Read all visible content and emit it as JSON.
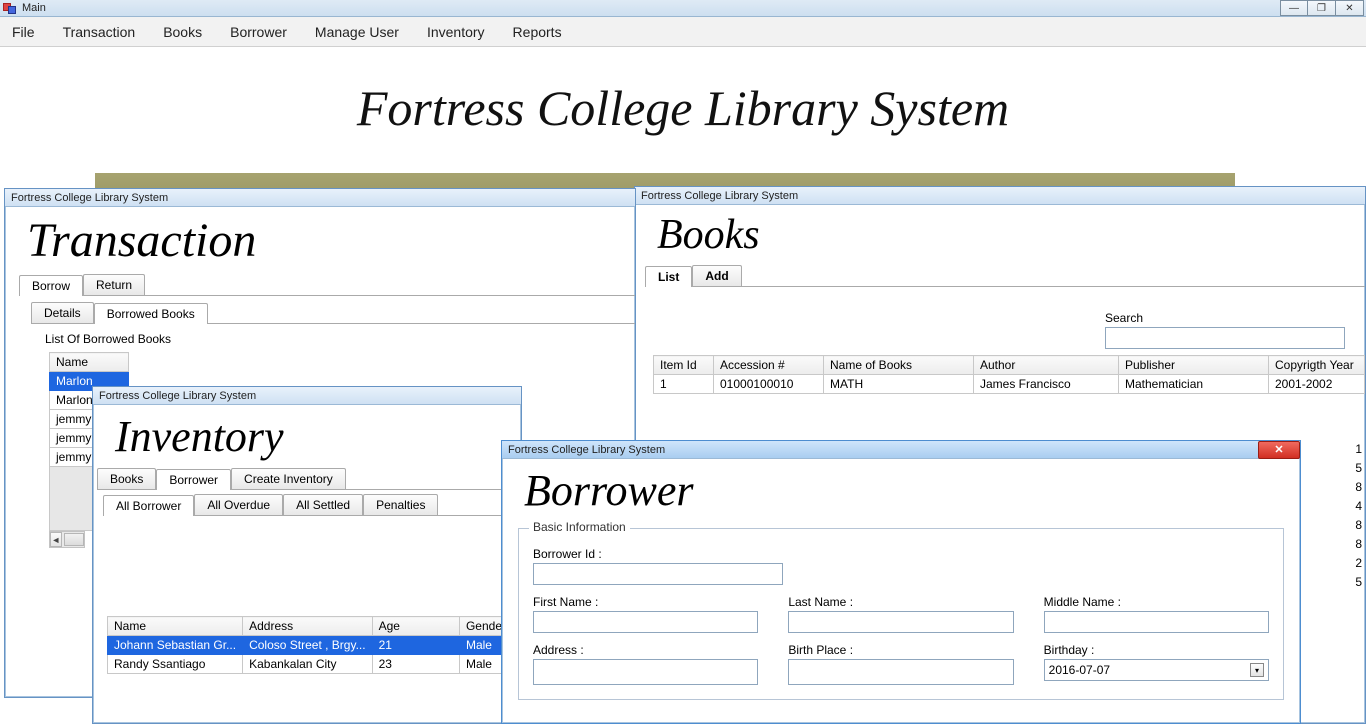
{
  "taskbar": {
    "title": "Main"
  },
  "win_controls": {
    "min": "—",
    "max": "❐",
    "close": "✕"
  },
  "menubar": [
    "File",
    "Transaction",
    "Books",
    "Borrower",
    "Manage User",
    "Inventory",
    "Reports"
  ],
  "main_title": "Fortress College Library System",
  "transaction": {
    "win_title": "Fortress College Library System",
    "heading": "Transaction",
    "tabs_a": {
      "borrow": "Borrow",
      "return": "Return"
    },
    "tabs_b": {
      "details": "Details",
      "borrowed": "Borrowed Books"
    },
    "list_label": "List Of Borrowed Books",
    "table": {
      "headers": [
        "Name"
      ],
      "rows": [
        "Marlon",
        "Marlon",
        "jemmy",
        "jemmy",
        "jemmy"
      ],
      "selected_index": 0
    }
  },
  "books": {
    "win_title": "Fortress College Library System",
    "heading": "Books",
    "tabs": {
      "list": "List",
      "add": "Add"
    },
    "search_label": "Search",
    "columns": [
      "Item Id",
      "Accession #",
      "Name of Books",
      "Author",
      "Publisher",
      "Copyrigth Year"
    ],
    "row": {
      "item_id": "1",
      "accession": "01000100010",
      "name": "MATH",
      "author": "James Francisco",
      "publisher": "Mathematician",
      "year": "2001-2002"
    },
    "trailing_digits": [
      "1",
      "5",
      "8",
      "4",
      "8",
      "8",
      "2",
      "5"
    ]
  },
  "inventory": {
    "win_title": "Fortress College Library System",
    "heading": "Inventory",
    "top_tabs": {
      "books": "Books",
      "borrower": "Borrower",
      "create": "Create Inventory"
    },
    "sub_tabs": {
      "all": "All Borrower",
      "overdue": "All Overdue",
      "settled": "All Settled",
      "pen": "Penalties"
    },
    "columns": [
      "Name",
      "Address",
      "Age",
      "Gender"
    ],
    "rows": [
      {
        "name": "Johann Sebastian Gr...",
        "address": "Coloso Street , Brgy...",
        "age": "21",
        "gender": "Male",
        "sel": true
      },
      {
        "name": "Randy Ssantiago",
        "address": "Kabankalan City",
        "age": "23",
        "gender": "Male",
        "sel": false
      }
    ]
  },
  "borrower": {
    "win_title": "Fortress College Library System",
    "heading": "Borrower",
    "legend": "Basic Information",
    "labels": {
      "id": "Borrower Id :",
      "first": "First Name :",
      "last": "Last Name :",
      "middle": "Middle Name :",
      "address": "Address :",
      "birthplace": "Birth Place :",
      "birthday": "Birthday :"
    },
    "birthday_value": "2016-07-07",
    "close_glyph": "✕"
  }
}
